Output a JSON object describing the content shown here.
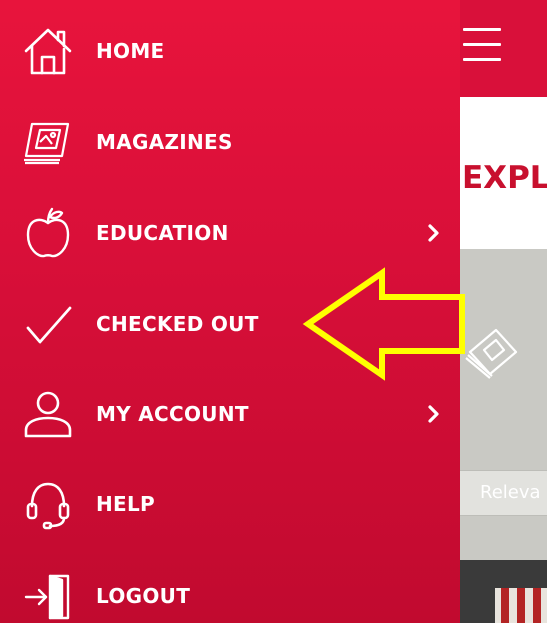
{
  "drawer": {
    "items": [
      {
        "label": "HOME",
        "icon": "home-icon",
        "has_submenu": false
      },
      {
        "label": "MAGAZINES",
        "icon": "magazine-icon",
        "has_submenu": false
      },
      {
        "label": "EDUCATION",
        "icon": "apple-icon",
        "has_submenu": true
      },
      {
        "label": "CHECKED OUT",
        "icon": "checkmark-icon",
        "has_submenu": false
      },
      {
        "label": "MY ACCOUNT",
        "icon": "user-icon",
        "has_submenu": true
      },
      {
        "label": "HELP",
        "icon": "headset-icon",
        "has_submenu": false
      },
      {
        "label": "LOGOUT",
        "icon": "logout-icon",
        "has_submenu": false
      }
    ],
    "background_color": "#d90f39",
    "text_color": "#ffffff"
  },
  "background_page": {
    "title": "EXPL",
    "sort_select_value": "Releva",
    "header_color": "#d9103a",
    "title_color": "#c8102e"
  },
  "annotation": {
    "type": "arrow",
    "color": "#ffff00",
    "points_to": "CHECKED OUT"
  }
}
